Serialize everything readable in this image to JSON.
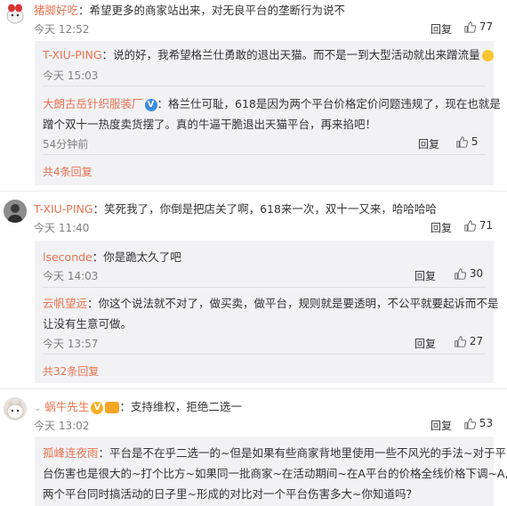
{
  "ui": {
    "reply_label": "回复",
    "accent": "#eb7350",
    "reply_bg": "#f2f2f5"
  },
  "comments": [
    {
      "user": "猪脚好吃",
      "text": "希望更多的商家站出来，对无良平台的垄断行为说不",
      "time": "今天 12:52",
      "likes": "77",
      "replies": [
        {
          "user": "T-XIU-PING",
          "text": "说的好，我希望格兰仕勇敢的退出天猫。而不是一到大型活动就出来蹭流量",
          "time": "今天 15:03",
          "likes": ""
        },
        {
          "user": "大朗古岳针织服装厂",
          "text_line1": "格兰仕可耻，618是因为两个平台价格定价问题违规了，现在也就是",
          "text_line2": "蹭个双十一热度卖货摆了。真的牛逼干脆退出天猫平台，再来掐吧！",
          "time": "54分钟前",
          "likes": "5"
        }
      ],
      "more": "共4条回复"
    },
    {
      "user": "T-XIU-PING",
      "text": "笑死我了，你倒是把店关了啊，618来一次，双十一又来，哈哈哈哈",
      "time": "今天 11:40",
      "likes": "71",
      "replies": [
        {
          "user": "lseconde",
          "text": "你是跪太久了吧",
          "time": "今天 14:03",
          "likes": "30"
        },
        {
          "user": "云帆望远",
          "text_line1": "你这个说法就不对了，做买卖，做平台，规则就是要透明，不公平就要起诉而不是",
          "text_line2": "让没有生意可做。",
          "time": "今天 13:57",
          "likes": "27"
        }
      ],
      "more": "共32条回复"
    },
    {
      "user": "蜗牛先生",
      "text": "支持维权，拒绝二选一",
      "time": "今天 13:02",
      "likes": "53",
      "replies": [
        {
          "user": "孤峰连夜雨",
          "text_line1": "平台是不在乎二选一的~但是如果有些商家背地里使用一些不风光的手法~对于平",
          "text_line2": "台伤害也是很大的~打个比方~如果同一批商家~在活动期间~在A平台的价格全线价格下调~A,B",
          "text_line3": "两个平台同时搞活动的日子里~形成的对比对一个平台伤害多大~你知道吗？"
        }
      ]
    }
  ]
}
